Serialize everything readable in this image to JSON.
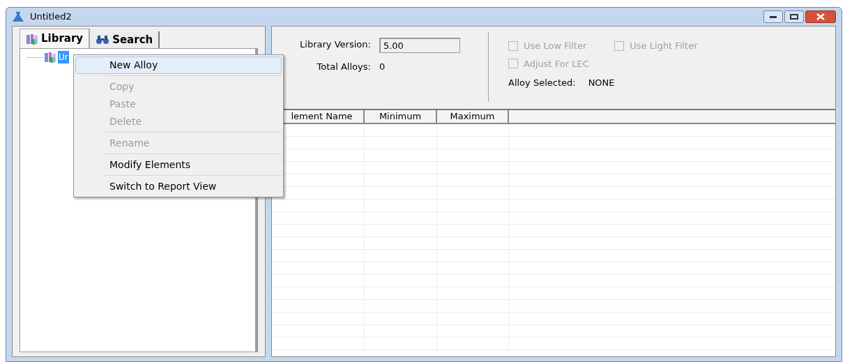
{
  "window": {
    "title": "Untitled2"
  },
  "tabs": [
    {
      "label": "Library",
      "selected": true
    },
    {
      "label": "Search",
      "selected": false
    }
  ],
  "tree": {
    "items": [
      {
        "label": "Ur",
        "selected": true
      }
    ]
  },
  "context_menu": {
    "groups": [
      [
        {
          "label": "New Alloy",
          "disabled": false,
          "selected": true
        }
      ],
      [
        {
          "label": "Copy",
          "disabled": true,
          "selected": false
        },
        {
          "label": "Paste",
          "disabled": true,
          "selected": false
        },
        {
          "label": "Delete",
          "disabled": true,
          "selected": false
        }
      ],
      [
        {
          "label": "Rename",
          "disabled": true,
          "selected": false
        }
      ],
      [
        {
          "label": "Modify Elements",
          "disabled": false,
          "selected": false
        }
      ],
      [
        {
          "label": "Switch to Report View",
          "disabled": false,
          "selected": false
        }
      ]
    ]
  },
  "info": {
    "library_version_label": "Library Version:",
    "library_version": "5.00",
    "total_alloys_label": "Total Alloys:",
    "total_alloys": "0",
    "alloy_selected_label": "Alloy Selected:",
    "alloy_selected": "NONE"
  },
  "options": [
    {
      "label": "Use Low Filter",
      "checked": false,
      "disabled": true
    },
    {
      "label": "Use Light Filter",
      "checked": false,
      "disabled": true
    },
    {
      "label": "Adjust For LEC",
      "checked": false,
      "disabled": true
    }
  ],
  "table": {
    "columns": [
      "lement Name",
      "Minimum",
      "Maximum"
    ]
  }
}
